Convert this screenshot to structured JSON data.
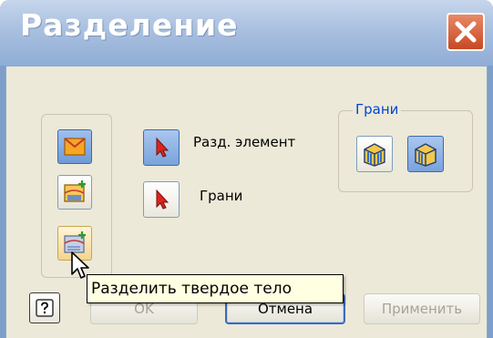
{
  "window": {
    "title": "Разделение"
  },
  "tools": {
    "mode_buttons": [
      {
        "icon": "split-face-mode-icon",
        "state": "active"
      },
      {
        "icon": "split-part-mode-icon",
        "state": "normal"
      },
      {
        "icon": "split-solid-body-mode-icon",
        "state": "hover"
      }
    ],
    "split_tool_label": "Разд. элемент",
    "faces_label": "Грани"
  },
  "faces_group": {
    "legend": "Грани",
    "buttons": [
      {
        "icon": "all-faces-icon",
        "state": "normal"
      },
      {
        "icon": "select-faces-icon",
        "state": "active"
      }
    ]
  },
  "footer": {
    "ok_label": "OK",
    "cancel_label": "Отмена",
    "apply_label": "Применить"
  },
  "tooltip": {
    "text": "Разделить твердое тело"
  },
  "colors": {
    "title_bar": "#a9c0df",
    "client_bg": "#ece9d8",
    "legend_text": "#0046d5",
    "tooltip_bg": "#ffffe1",
    "close_button": "#d45a34"
  }
}
